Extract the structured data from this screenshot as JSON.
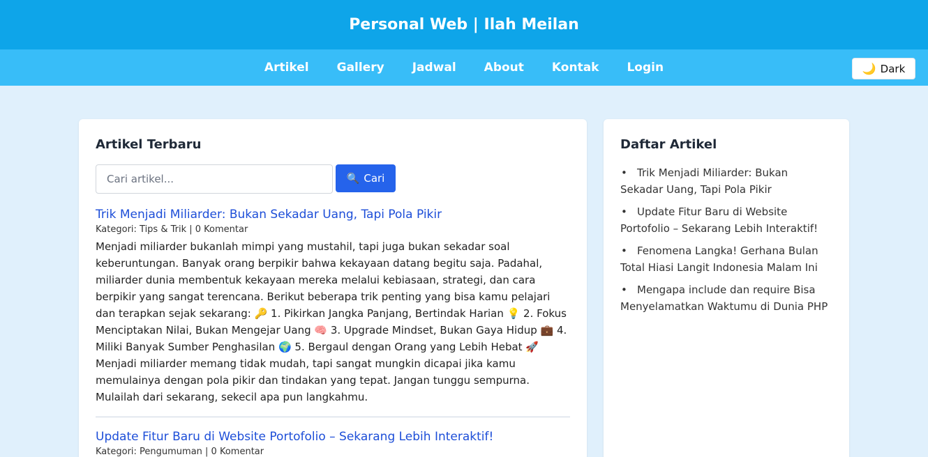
{
  "header": {
    "title": "Personal Web | Ilah Meilan"
  },
  "nav": {
    "items": [
      "Artikel",
      "Gallery",
      "Jadwal",
      "About",
      "Kontak",
      "Login"
    ],
    "dark_label": "Dark",
    "dark_icon": "moon-icon"
  },
  "main": {
    "heading": "Artikel Terbaru",
    "search": {
      "placeholder": "Cari artikel...",
      "value": "",
      "button_label": "Cari",
      "button_icon": "magnifier-icon"
    },
    "articles": [
      {
        "title": "Trik Menjadi Miliarder: Bukan Sekadar Uang, Tapi Pola Pikir",
        "meta": "Kategori: Tips & Trik | 0 Komentar",
        "body": "Menjadi miliarder bukanlah mimpi yang mustahil, tapi juga bukan sekadar soal keberuntungan. Banyak orang berpikir bahwa kekayaan datang begitu saja. Padahal, miliarder dunia membentuk kekayaan mereka melalui kebiasaan, strategi, dan cara berpikir yang sangat terencana. Berikut beberapa trik penting yang bisa kamu pelajari dan terapkan sejak sekarang: 🔑 1. Pikirkan Jangka Panjang, Bertindak Harian 💡 2. Fokus Menciptakan Nilai, Bukan Mengejar Uang 🧠 3. Upgrade Mindset, Bukan Gaya Hidup 💼 4. Miliki Banyak Sumber Penghasilan 🌍 5. Bergaul dengan Orang yang Lebih Hebat 🚀 Menjadi miliarder memang tidak mudah, tapi sangat mungkin dicapai jika kamu memulainya dengan pola pikir dan tindakan yang tepat. Jangan tunggu sempurna. Mulailah dari sekarang, sekecil apa pun langkahmu."
      },
      {
        "title": "Update Fitur Baru di Website Portofolio – Sekarang Lebih Interaktif!",
        "meta": "Kategori: Pengumuman | 0 Komentar"
      }
    ]
  },
  "sidebar": {
    "heading": "Daftar Artikel",
    "items": [
      "Trik Menjadi Miliarder: Bukan Sekadar Uang, Tapi Pola Pikir",
      "Update Fitur Baru di Website Portofolio – Sekarang Lebih Interaktif!",
      "Fenomena Langka! Gerhana Bulan Total Hiasi Langit Indonesia Malam Ini",
      "Mengapa include dan require Bisa Menyelamatkan Waktumu di Dunia PHP"
    ]
  }
}
